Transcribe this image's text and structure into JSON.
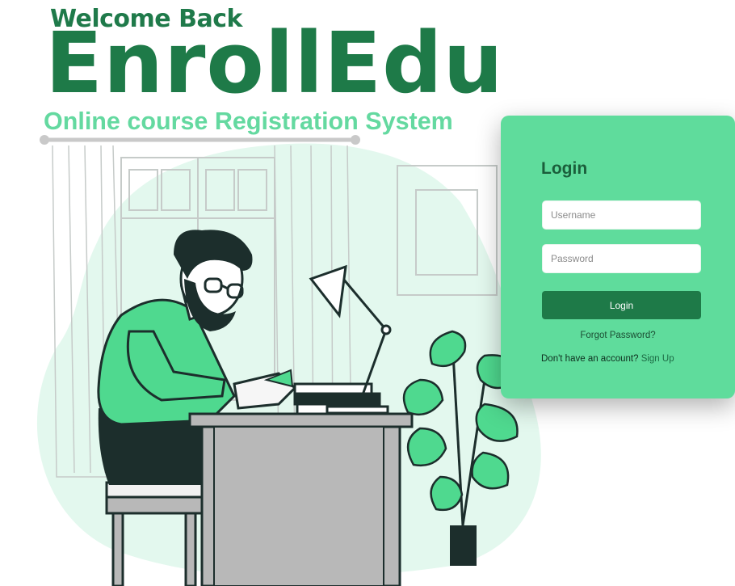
{
  "header": {
    "welcome": "Welcome Back",
    "brand": "EnrollEdu",
    "tagline": "Online course Registration System"
  },
  "login": {
    "title": "Login",
    "username_placeholder": "Username",
    "password_placeholder": "Password",
    "button_label": "Login",
    "forgot_link": "Forgot Password?",
    "signup_prompt": "Don't have an account?",
    "signup_link": "Sign Up"
  },
  "colors": {
    "brand_dark_green": "#1e7a48",
    "tagline_green": "#64d9a0",
    "card_green": "#5fdc9c",
    "blob_mint": "#e3f8ee",
    "shirt_green": "#4fd98f",
    "dark_teal": "#1c2e2c"
  }
}
